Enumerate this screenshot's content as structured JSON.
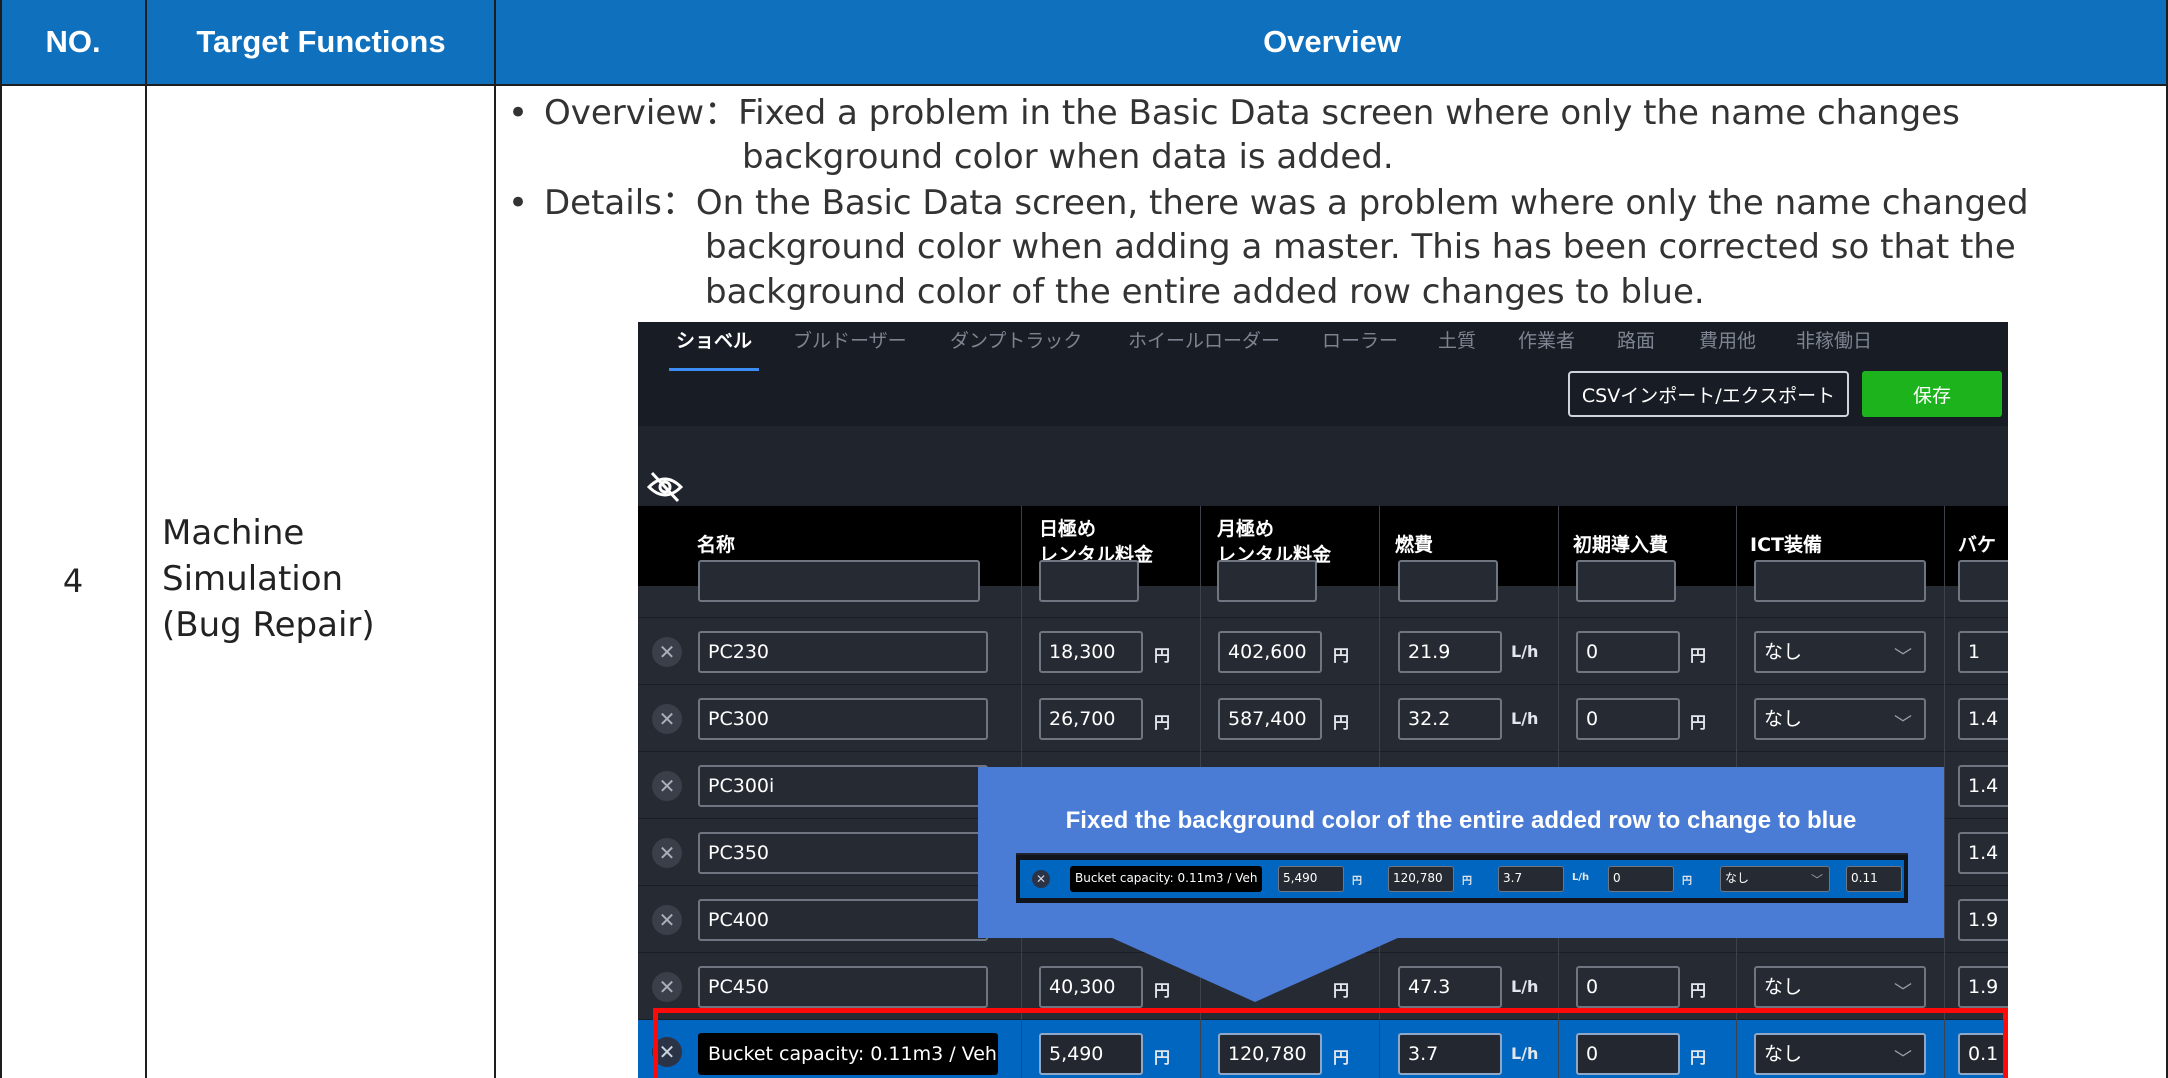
{
  "table": {
    "headers": {
      "no": "NO.",
      "functions": "Target Functions",
      "overview": "Overview"
    },
    "row": {
      "no": "4",
      "function_lines": [
        "Machine",
        "Simulation",
        "(Bug Repair)"
      ],
      "bullet_overview": {
        "line1": "Overview：Fixed a problem in the Basic Data screen where only the name changes",
        "line2": "background color when data is added."
      },
      "bullet_details": {
        "line1": "Details：On the Basic Data screen, there was a problem where only the name changed",
        "line2": "background color when adding a master. This has been corrected so that the",
        "line3": "background color of the entire added row changes to blue."
      }
    }
  },
  "screenshot": {
    "tabs": [
      "ショベル",
      "ブルドーザー",
      "ダンプトラック",
      "ホイールローダー",
      "ローラー",
      "土質",
      "作業者",
      "路面",
      "費用他",
      "非稼働日"
    ],
    "active_tab": "ショベル",
    "buttons": {
      "csv": "CSVインポート/エクスポート",
      "save": "保存"
    },
    "columns": {
      "name": "名称",
      "daily_1": "日極め",
      "daily_2": "レンタル料金",
      "monthly_1": "月極め",
      "monthly_2": "レンタル料金",
      "fuel": "燃費",
      "initial": "初期導入費",
      "ict": "ICT装備",
      "bucket": "バケッ"
    },
    "units": {
      "yen": "円",
      "lh": "L/h"
    },
    "rows": [
      {
        "name": "PC230",
        "daily": "18,300",
        "monthly": "402,600",
        "fuel": "21.9",
        "initial": "0",
        "ict": "なし",
        "bucket": "1"
      },
      {
        "name": "PC300",
        "daily": "26,700",
        "monthly": "587,400",
        "fuel": "32.2",
        "initial": "0",
        "ict": "なし",
        "bucket": "1.4"
      },
      {
        "name": "PC300i",
        "bucket": "1.4"
      },
      {
        "name": "PC350",
        "bucket": "1.4"
      },
      {
        "name": "PC400",
        "bucket": "1.9"
      },
      {
        "name": "PC450",
        "daily": "40,300",
        "fuel": "47.3",
        "initial": "0",
        "ict": "なし",
        "bucket": "1.9"
      }
    ],
    "added_row": {
      "name": "Bucket capacity: 0.11m3 / Veh",
      "daily": "5,490",
      "monthly": "120,780",
      "fuel": "3.7",
      "initial": "0",
      "ict": "なし",
      "bucket": "0.1"
    },
    "callout": {
      "text": "Fixed the background color of the entire added row to change to blue",
      "mini_row": {
        "name": "Bucket capacity: 0.11m3 / Veh",
        "daily": "5,490",
        "monthly": "120,780",
        "fuel": "3.7",
        "initial": "0",
        "ict": "なし",
        "bucket": "0.11"
      }
    },
    "colors": {
      "added_row_blue": "#0066c0",
      "highlight_red": "#ff0a0a",
      "callout_blue": "#4a7cd6",
      "save_green": "#1db31d"
    }
  }
}
